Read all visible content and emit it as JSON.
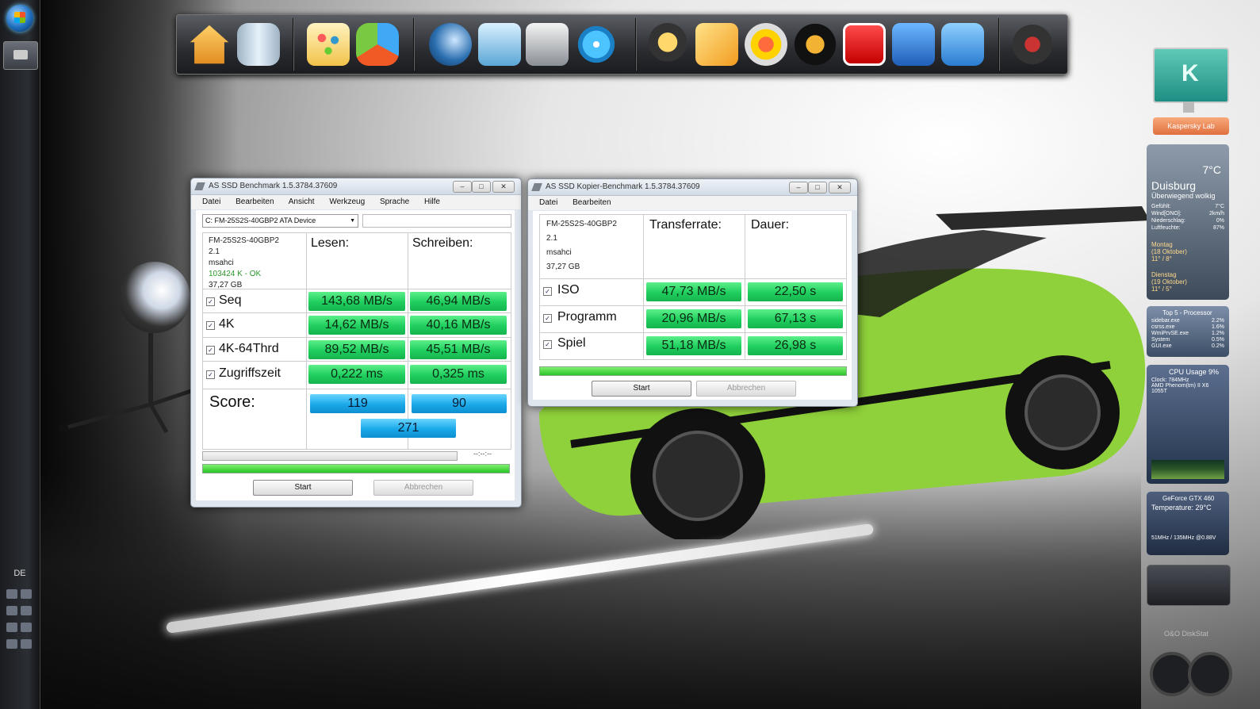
{
  "taskbar": {
    "language": "DE"
  },
  "gadgets": {
    "kaspersky_label": "Kaspersky Lab",
    "weather": {
      "temp": "7°C",
      "city": "Duisburg",
      "condition": "Überwiegend wolkig",
      "stats": [
        {
          "k": "Gefühlt:",
          "v": "7°C"
        },
        {
          "k": "Wind[ONO]:",
          "v": "2km/h"
        },
        {
          "k": "Niederschlag:",
          "v": "0%"
        },
        {
          "k": "Luftfeuchte:",
          "v": "87%"
        }
      ],
      "day1": {
        "name": "Montag",
        "date": "(18 Oktober)",
        "range": "11° / 8°"
      },
      "day2": {
        "name": "Dienstag",
        "date": "(19 Oktober)",
        "range": "11° / 5°"
      }
    },
    "top5": {
      "title": "Top 5 - Processor",
      "rows": [
        {
          "n": "sidebar.exe",
          "v": "2.2%"
        },
        {
          "n": "csrss.exe",
          "v": "1.6%"
        },
        {
          "n": "WmiPrvSE.exe",
          "v": "1.2%"
        },
        {
          "n": "System",
          "v": "0.5%"
        },
        {
          "n": "GUI.exe",
          "v": "0.2%"
        }
      ]
    },
    "cpu": {
      "title": "CPU Usage",
      "value": "9%",
      "clock": "Clock: 784MHz",
      "model": "AMD Phenom(tm) II X6 1055T"
    },
    "gpu": {
      "title": "GeForce GTX 460",
      "temp": "Temperature: 29°C",
      "clock": "51MHz / 135MHz @0.88V"
    },
    "disk_label": "O&O DiskStat"
  },
  "bench": {
    "title": "AS SSD Benchmark 1.5.3784.37609",
    "menu": [
      "Datei",
      "Bearbeiten",
      "Ansicht",
      "Werkzeug",
      "Sprache",
      "Hilfe"
    ],
    "drive": "C: FM-25S2S-40GBP2 ATA Device",
    "info": {
      "model": "FM-25S2S-40GBP2",
      "firmware": "2.1",
      "driver": "msahci",
      "align": "103424 K - OK",
      "size": "37,27 GB"
    },
    "col_read": "Lesen:",
    "col_write": "Schreiben:",
    "rows": [
      {
        "label": "Seq",
        "read": "143,68 MB/s",
        "write": "46,94 MB/s"
      },
      {
        "label": "4K",
        "read": "14,62 MB/s",
        "write": "40,16 MB/s"
      },
      {
        "label": "4K-64Thrd",
        "read": "89,52 MB/s",
        "write": "45,51 MB/s"
      },
      {
        "label": "Zugriffszeit",
        "read": "0,222 ms",
        "write": "0,325 ms"
      }
    ],
    "score_label": "Score:",
    "score_read": "119",
    "score_write": "90",
    "score_total": "271",
    "time": "--:--:--",
    "start": "Start",
    "cancel": "Abbrechen"
  },
  "copy": {
    "title": "AS SSD Kopier-Benchmark 1.5.3784.37609",
    "menu": [
      "Datei",
      "Bearbeiten"
    ],
    "info": {
      "model": "FM-25S2S-40GBP2",
      "firmware": "2.1",
      "driver": "msahci",
      "size": "37,27 GB"
    },
    "col_rate": "Transferrate:",
    "col_dur": "Dauer:",
    "rows": [
      {
        "label": "ISO",
        "rate": "47,73 MB/s",
        "dur": "22,50 s"
      },
      {
        "label": "Programm",
        "rate": "20,96 MB/s",
        "dur": "67,13 s"
      },
      {
        "label": "Spiel",
        "rate": "51,18 MB/s",
        "dur": "26,98 s"
      }
    ],
    "start": "Start",
    "cancel": "Abbrechen"
  },
  "colors": {
    "green_value": "#1fce5e",
    "blue_score": "#1aa8e8",
    "car": "#8fd13a"
  }
}
